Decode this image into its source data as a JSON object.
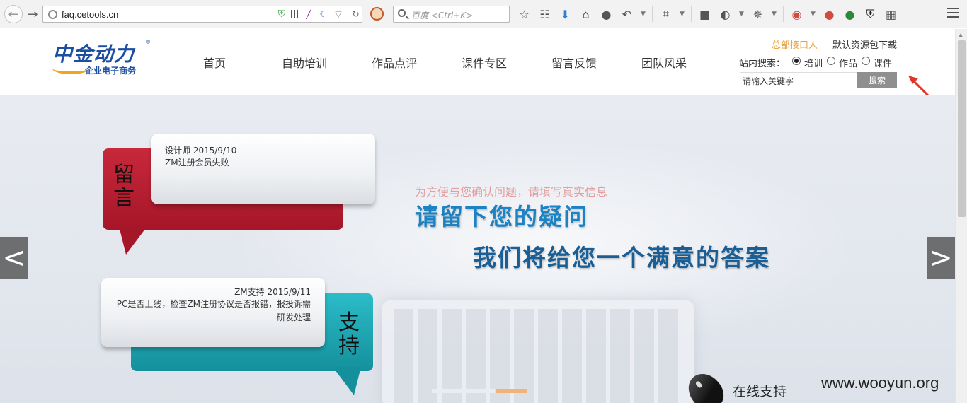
{
  "browser": {
    "url": "faq.cetools.cn",
    "search_placeholder": "百度 <Ctrl+K>"
  },
  "site": {
    "logo_text": "中金动力",
    "logo_sub": "企业电子商务",
    "logo_reg": "®",
    "nav": [
      "首页",
      "自助培训",
      "作品点评",
      "课件专区",
      "留言反馈",
      "团队风采"
    ],
    "links": {
      "contact": "总部接口人",
      "download": "默认资源包下载"
    },
    "search": {
      "label": "站内搜索：",
      "options": [
        "培训",
        "作品",
        "课件"
      ],
      "selected": "培训",
      "input_value": "请输入关键字",
      "button": "搜索"
    }
  },
  "banner": {
    "hint": "为方便与您确认问题，请填写真实信息",
    "headline1": "请留下您的疑问",
    "headline2": "我们将给您一个满意的答案",
    "message_label": "留言",
    "message_meta": "设计师  2015/9/10",
    "message_text": "ZM注册会员失败",
    "support_label": "支持",
    "support_meta": "ZM支持  2015/9/11",
    "support_text": "PC是否上线，检查ZM注册协议是否报错，报投诉需研发处理",
    "online_support": "在线支持",
    "prev": "<",
    "next": ">",
    "watermark": "www.wooyun.org"
  },
  "colors": {
    "accent_blue": "#1b82c4",
    "message_red": "#a51628",
    "support_teal": "#14909c",
    "contact_link": "#e8a03c"
  }
}
